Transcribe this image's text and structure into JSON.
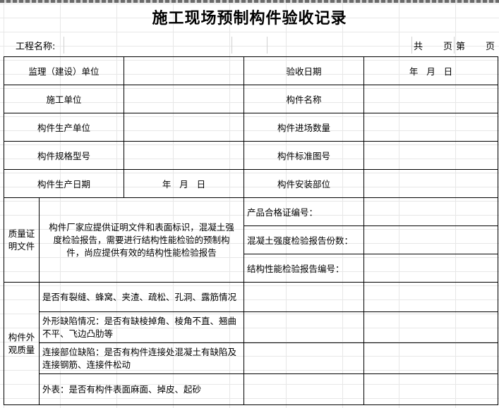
{
  "title": "施工现场预制构件验收记录",
  "info": {
    "project_label": "工程名称:",
    "total_label": "共",
    "page_label": "页",
    "page_no_label": "第",
    "page_label2": "页"
  },
  "rows": {
    "supervisor_unit": "监理（建设）单位",
    "acceptance_date": "验收日期",
    "date_placeholder": "年   月   日",
    "construction_unit": "施工单位",
    "component_name": "构件名称",
    "production_unit": "构件生产单位",
    "arrival_quantity": "构件进场数量",
    "spec_model": "构件规格型号",
    "standard_drawing": "构件标准图号",
    "production_date": "构件生产日期",
    "production_date_value": "年   月   日",
    "install_location": "构件安装部位"
  },
  "quality_docs": {
    "label": "质量证明文件",
    "note": "构件厂家应提供证明文件和表面标识，混凝土强度检验报告，需要进行结构性能检验的预制构件，尚应提供有效的结构性能检验报告",
    "cert_no": "产品合格证编号：",
    "concrete_report": "混凝土强度检验报告份数：",
    "structure_report": "结构性能检验报告编号："
  },
  "appearance": {
    "label": "构件外观质量",
    "items": [
      "是否有裂缝、蜂窝、夹渣、疏松、孔洞、露筋情况",
      "外形缺陷情况：是否有缺棱掉角、棱角不直、翘曲不平、飞边凸肋等",
      "连接部位缺陷：是否有构件连接处混凝土有缺陷及连接钢筋、连接件松动",
      "外表：是否有构件表面麻面、掉皮、起砂"
    ]
  }
}
